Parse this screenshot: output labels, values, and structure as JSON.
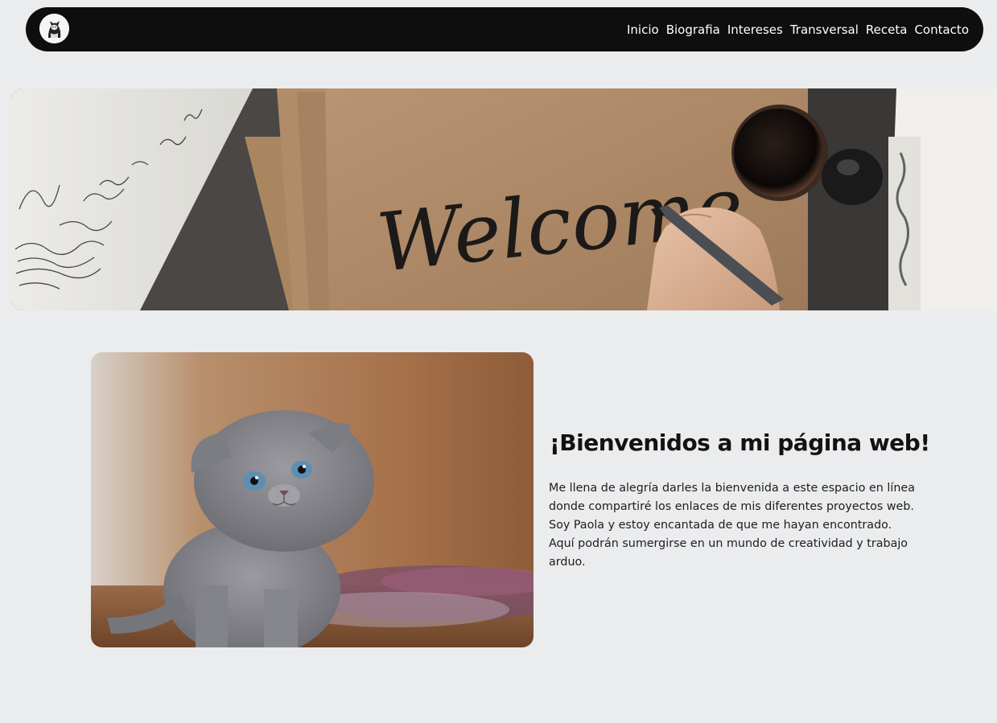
{
  "nav": {
    "links": [
      {
        "label": "Inicio"
      },
      {
        "label": "Biografia"
      },
      {
        "label": "Intereses"
      },
      {
        "label": "Transversal"
      },
      {
        "label": "Receta"
      },
      {
        "label": "Contacto"
      }
    ]
  },
  "hero": {
    "handwritten_word": "Welcome"
  },
  "intro": {
    "title": "¡Bienvenidos a mi página web!",
    "paragraph": "Me llena de alegría darles la bienvenida a este espacio en línea donde compartiré los enlaces de mis diferentes proyectos web. Soy Paola y estoy encantada de que me hayan encontrado. Aquí podrán sumergirse en un mundo de creatividad y trabajo arduo."
  },
  "colors": {
    "page_background": "#ebecee",
    "navbar_background": "#0e0e0e",
    "nav_text": "#ffffff",
    "title_text": "#121212"
  }
}
